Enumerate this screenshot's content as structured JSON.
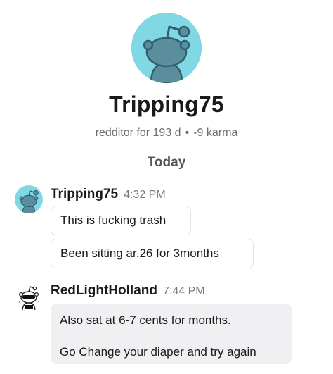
{
  "profile": {
    "avatar_icon": "reddit-snoo-icon",
    "avatar_color": "#7fd8e4",
    "username": "Tripping75",
    "meta_age": "redditor for 193 d",
    "meta_separator": "•",
    "meta_karma": "-9 karma"
  },
  "divider": {
    "label": "Today"
  },
  "messages": [
    {
      "author": "Tripping75",
      "time": "4:32 PM",
      "avatar_icon": "reddit-snoo-icon",
      "texts": [
        "This is fucking trash",
        "Been sitting ar.26 for 3months"
      ]
    },
    {
      "author": "RedLightHolland",
      "time": "7:44 PM",
      "avatar_icon": "snoo-sunglasses-avatar-icon",
      "texts": [
        "Also sat at 6-7 cents for months.",
        "Go Change your diaper and try again"
      ]
    }
  ]
}
